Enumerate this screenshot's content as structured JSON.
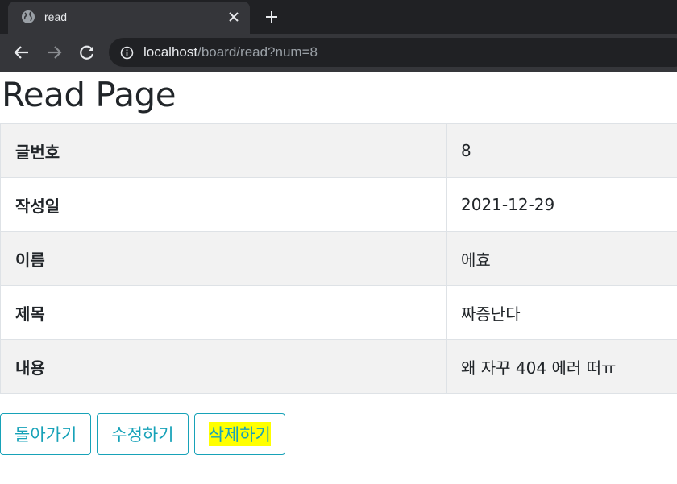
{
  "browser": {
    "tab": {
      "title": "read",
      "favicon": "globe-icon",
      "close_icon": "close-icon"
    },
    "new_tab_icon": "plus-icon",
    "nav": {
      "back_icon": "arrow-left-icon",
      "forward_icon": "arrow-right-icon",
      "reload_icon": "reload-icon"
    },
    "address": {
      "info_icon": "info-icon",
      "host": "localhost",
      "path": "/board/read?num=8"
    }
  },
  "page": {
    "title": "Read Page",
    "rows": [
      {
        "label": "글번호",
        "value": "8"
      },
      {
        "label": "작성일",
        "value": "2021-12-29"
      },
      {
        "label": "이름",
        "value": "에효"
      },
      {
        "label": "제목",
        "value": "짜증난다"
      },
      {
        "label": "내용",
        "value": "왜 자꾸 404 에러 떠ㅠ"
      }
    ],
    "buttons": {
      "back": "돌아가기",
      "edit": "수정하기",
      "delete": "삭제하기"
    }
  },
  "colors": {
    "accent": "#17a2b8",
    "highlight": "#ffff00",
    "chrome_dark": "#202124",
    "chrome_mid": "#35363a"
  }
}
